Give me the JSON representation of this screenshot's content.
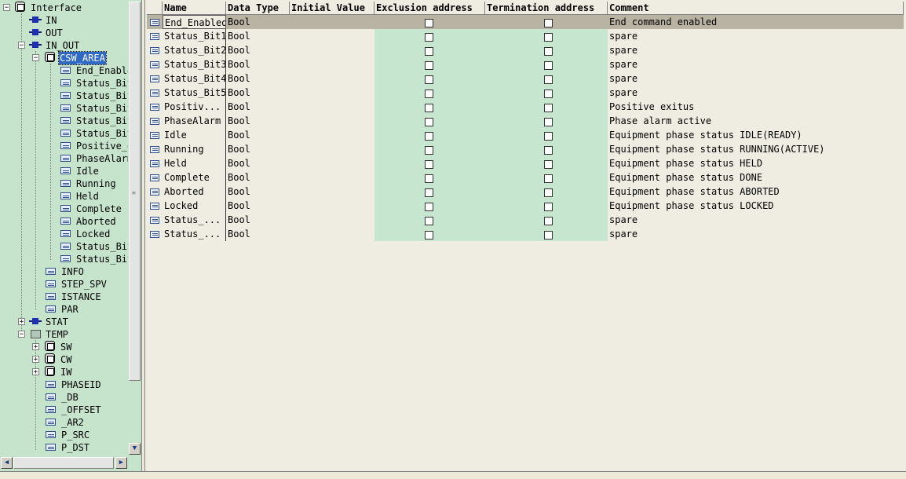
{
  "tree": {
    "root": "Interface",
    "in": "IN",
    "out": "OUT",
    "in_out": "IN_OUT",
    "csw_area": "CSW_AREA",
    "csw_items": [
      "End_Enable",
      "Status_Bit",
      "Status_Bit",
      "Status_Bit",
      "Status_Bit",
      "Status_Bit",
      "Positive_e",
      "PhaseAlarm",
      "Idle",
      "Running",
      "Held",
      "Complete",
      "Aborted",
      "Locked",
      "Status_Bit",
      "Status_Bit"
    ],
    "in_out_items": [
      "INFO",
      "STEP_SPV",
      "ISTANCE",
      "PAR"
    ],
    "stat": "STAT",
    "temp": "TEMP",
    "temp_structs": [
      "SW",
      "CW",
      "IW"
    ],
    "temp_items": [
      "PHASEID",
      "_DB",
      "_OFFSET",
      "_AR2",
      "P_SRC",
      "P_DST"
    ]
  },
  "table": {
    "headers": {
      "name": "Name",
      "data_type": "Data Type",
      "initial_value": "Initial Value",
      "exclusion_address": "Exclusion address",
      "termination_address": "Termination address",
      "comment": "Comment"
    },
    "rows": [
      {
        "name": "End_Enabled",
        "type": "Bool",
        "comment": "End command enabled"
      },
      {
        "name": "Status_Bit1",
        "type": "Bool",
        "comment": "spare"
      },
      {
        "name": "Status_Bit2",
        "type": "Bool",
        "comment": "spare"
      },
      {
        "name": "Status_Bit3",
        "type": "Bool",
        "comment": "spare"
      },
      {
        "name": "Status_Bit4",
        "type": "Bool",
        "comment": "spare"
      },
      {
        "name": "Status_Bit5",
        "type": "Bool",
        "comment": "spare"
      },
      {
        "name": "Positiv...",
        "type": "Bool",
        "comment": "Positive exitus"
      },
      {
        "name": "PhaseAlarm",
        "type": "Bool",
        "comment": "Phase alarm active"
      },
      {
        "name": "Idle",
        "type": "Bool",
        "comment": "Equipment phase status IDLE(READY)"
      },
      {
        "name": "Running",
        "type": "Bool",
        "comment": "Equipment phase status RUNNING(ACTIVE)"
      },
      {
        "name": "Held",
        "type": "Bool",
        "comment": "Equipment phase status HELD"
      },
      {
        "name": "Complete",
        "type": "Bool",
        "comment": "Equipment phase status DONE"
      },
      {
        "name": "Aborted",
        "type": "Bool",
        "comment": "Equipment phase status ABORTED"
      },
      {
        "name": "Locked",
        "type": "Bool",
        "comment": "Equipment phase status LOCKED"
      },
      {
        "name": "Status_...",
        "type": "Bool",
        "comment": "spare"
      },
      {
        "name": "Status_...",
        "type": "Bool",
        "comment": "spare"
      }
    ]
  },
  "colors": {
    "tree_bg": "#c6e4cc",
    "green_cells": "#c7e6cf",
    "selection_blue": "#316ac5",
    "selected_row": "#b8b3a2",
    "pane_bg": "#efede2"
  },
  "icons": {
    "root": "interface-icon",
    "param_group": "parameter-plug-icon",
    "struct": "struct-icon",
    "variable": "variable-icon",
    "temp": "temp-folder-icon"
  }
}
